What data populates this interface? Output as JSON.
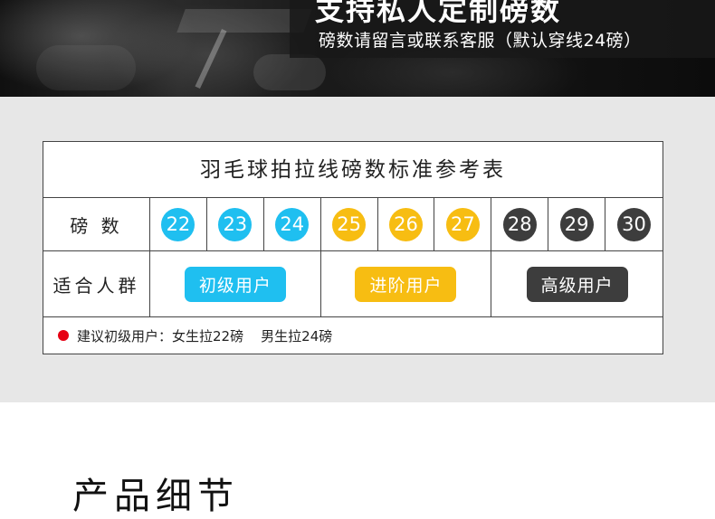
{
  "banner": {
    "title": "支持私人定制磅数",
    "subtitle": "磅数请留言或联系客服（默认穿线24磅）"
  },
  "table": {
    "title": "羽毛球拍拉线磅数标准参考表",
    "pounds_label": "磅 数",
    "pounds": [
      {
        "value": "22",
        "color": "#1fbff0"
      },
      {
        "value": "23",
        "color": "#1fbff0"
      },
      {
        "value": "24",
        "color": "#1fbff0"
      },
      {
        "value": "25",
        "color": "#f7bd12"
      },
      {
        "value": "26",
        "color": "#f7bd12"
      },
      {
        "value": "27",
        "color": "#f7bd12"
      },
      {
        "value": "28",
        "color": "#3d3d3d"
      },
      {
        "value": "29",
        "color": "#3d3d3d"
      },
      {
        "value": "30",
        "color": "#3d3d3d"
      }
    ],
    "group_label": "适合人群",
    "groups": [
      {
        "label": "初级用户",
        "color": "#1fbff0"
      },
      {
        "label": "进阶用户",
        "color": "#f7bd12"
      },
      {
        "label": "高级用户",
        "color": "#3d3d3d"
      }
    ],
    "note": "建议初级用户：女生拉22磅    男生拉24磅",
    "note_dot_color": "#e60012"
  },
  "section": {
    "heading": "产品细节"
  }
}
